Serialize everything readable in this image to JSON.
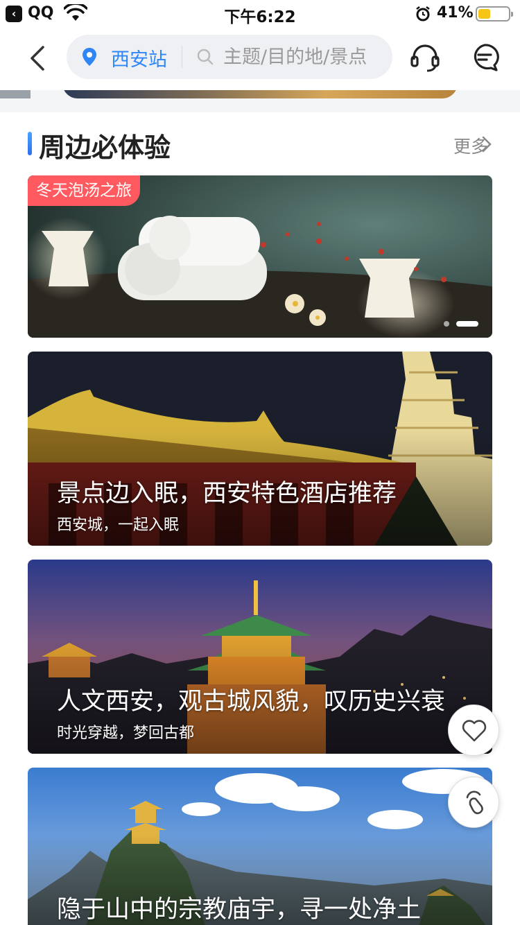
{
  "status_bar": {
    "app": "QQ",
    "time": "下午6:22",
    "battery": "41%",
    "battery_level": 0.41
  },
  "nav": {
    "location": "西安站",
    "search_placeholder": "主题/目的地/景点"
  },
  "section": {
    "title": "周边必体验",
    "more": "更多"
  },
  "cards": [
    {
      "tag": "冬天泡汤之旅"
    },
    {
      "title": "景点边入眠，西安特色酒店推荐",
      "subtitle": "西安城，一起入眠"
    },
    {
      "title": "人文西安，观古城风貌，叹历史兴衰",
      "subtitle": "时光穿越，梦回古都"
    },
    {
      "title": "隐于山中的宗教庙宇，寻一处净土"
    }
  ],
  "colors": {
    "accent_blue": "#2f86f6",
    "tag_red": "#ff5a5f",
    "battery_yellow": "#f5c518"
  },
  "icons": {
    "back": "chevron-left-icon",
    "location": "map-pin-icon",
    "search": "search-icon",
    "customer_service": "headset-icon",
    "messages": "chat-bubble-icon",
    "favorite": "heart-icon",
    "assistant": "assistant-icon"
  }
}
